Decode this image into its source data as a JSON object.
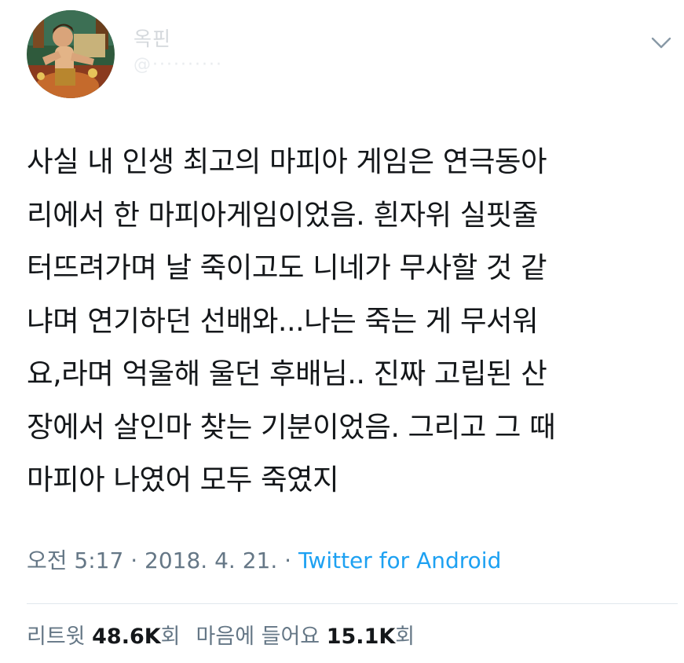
{
  "author": {
    "display_name": "옥핀",
    "handle": "@··········"
  },
  "tweet": {
    "text": "사실 내 인생 최고의 마피아 게임은 연극동아\n리에서 한 마피아게임이었음. 흰자위 실핏줄\n터뜨려가며 날 죽이고도 니네가 무사할 것 같\n냐며 연기하던 선배와...나는 죽는 게 무서워\n요,라며 억울해 울던 후배님.. 진짜 고립된 산\n장에서 살인마 찾는 기분이었음. 그리고 그 때\n마피아 나였어 모두 죽였지",
    "time": "오전 5:17",
    "date": "2018. 4. 21.",
    "separator": "·",
    "source": "Twitter for Android"
  },
  "stats": {
    "retweets_label": "리트윗",
    "retweets_count": "48.6K",
    "retweets_unit": "회",
    "likes_label": "마음에 들어요",
    "likes_count": "15.1K",
    "likes_unit": "회"
  },
  "icons": {
    "menu": "chevron-down-icon",
    "avatar": "profile-avatar"
  },
  "colors": {
    "text": "#14171a",
    "muted": "#657786",
    "link": "#1da1f2",
    "divider": "#e1e8ed"
  }
}
